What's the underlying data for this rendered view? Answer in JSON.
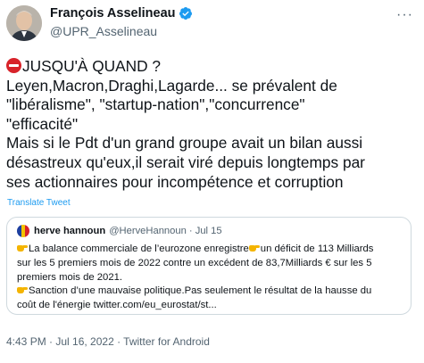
{
  "author": {
    "display_name": "François Asselineau",
    "handle": "@UPR_Asselineau",
    "verified": true
  },
  "tweet": {
    "lines": [
      "JUSQU'À QUAND ?",
      "Leyen,Macron,Draghi,Lagarde... se prévalent de",
      "\"libéralisme\", \"startup-nation\",\"concurrence\"",
      "\"efficacité\"",
      "Mais si le Pdt d'un grand groupe avait un bilan aussi",
      "désastreux qu'eux,il serait viré depuis longtemps par",
      "ses actionnaires pour incompétence et corruption"
    ],
    "translate_label": "Translate Tweet"
  },
  "quoted_tweet": {
    "display_name": "herve hannoun",
    "handle_date": "@HerveHannoun · Jul 15",
    "lines": [
      "La balance commerciale de l’eurozone enregistre",
      "un déficit de 113 Milliards",
      "sur les 5 premiers mois de 2022 contre un excédent de 83,7Milliards € sur les 5",
      "premiers mois de 2021.",
      "Sanction d’une mauvaise politique.Pas seulement le résultat de la hausse du",
      "coût de l'énergie twitter.com/eu_eurostat/st..."
    ]
  },
  "footer": {
    "timestamp": "4:43 PM · Jul 16, 2022 · Twitter for Android"
  },
  "colors": {
    "link": "#1d9bf0",
    "secondary_text": "#536471",
    "no_entry_red": "#d8232a",
    "border": "#cfd9de"
  }
}
